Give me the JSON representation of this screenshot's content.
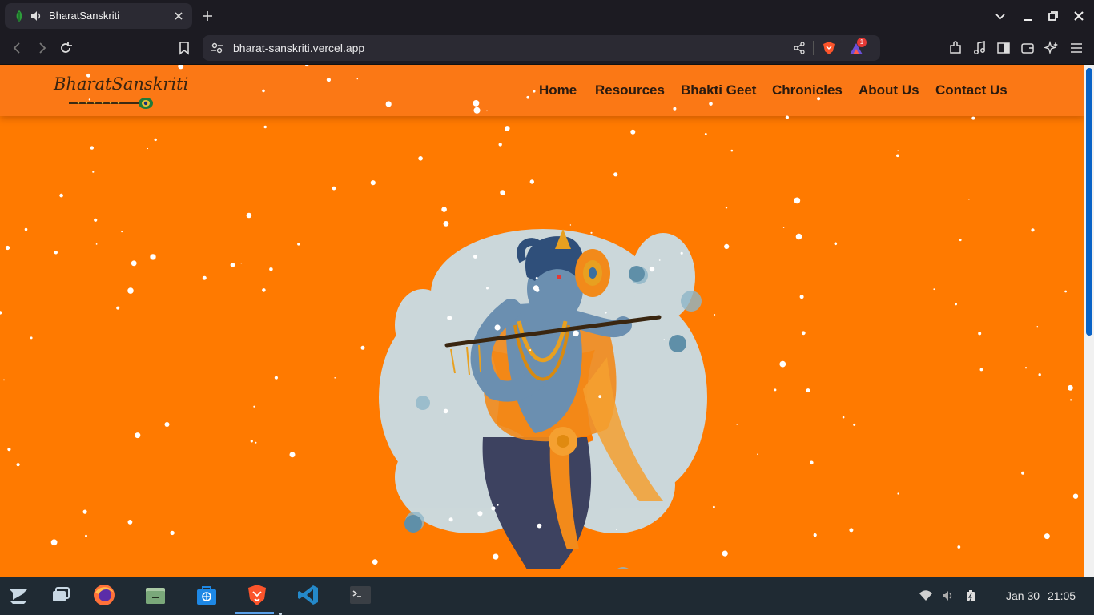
{
  "browser": {
    "tab_title": "BharatSanskriti",
    "url": "bharat-sanskriti.vercel.app",
    "notification_count": "1"
  },
  "site": {
    "logo": "BharatSanskriti",
    "nav": [
      "Home",
      "Resources",
      "Bhakti Geet",
      "Chronicles",
      "About Us",
      "Contact Us"
    ],
    "hero_image": "krishna-playing-flute-illustration"
  },
  "colors": {
    "page_bg": "#ff7a00",
    "navbar_bg": "#fb7815",
    "nav_text": "#2a1a0f",
    "snow": "#ffffff"
  },
  "taskbar": {
    "apps": [
      "zorin-menu-icon",
      "workspaces-icon",
      "firefox-icon",
      "files-icon",
      "software-store-icon",
      "brave-icon",
      "vscode-icon",
      "terminal-icon"
    ],
    "date": "Jan 30",
    "time": "21:05"
  }
}
